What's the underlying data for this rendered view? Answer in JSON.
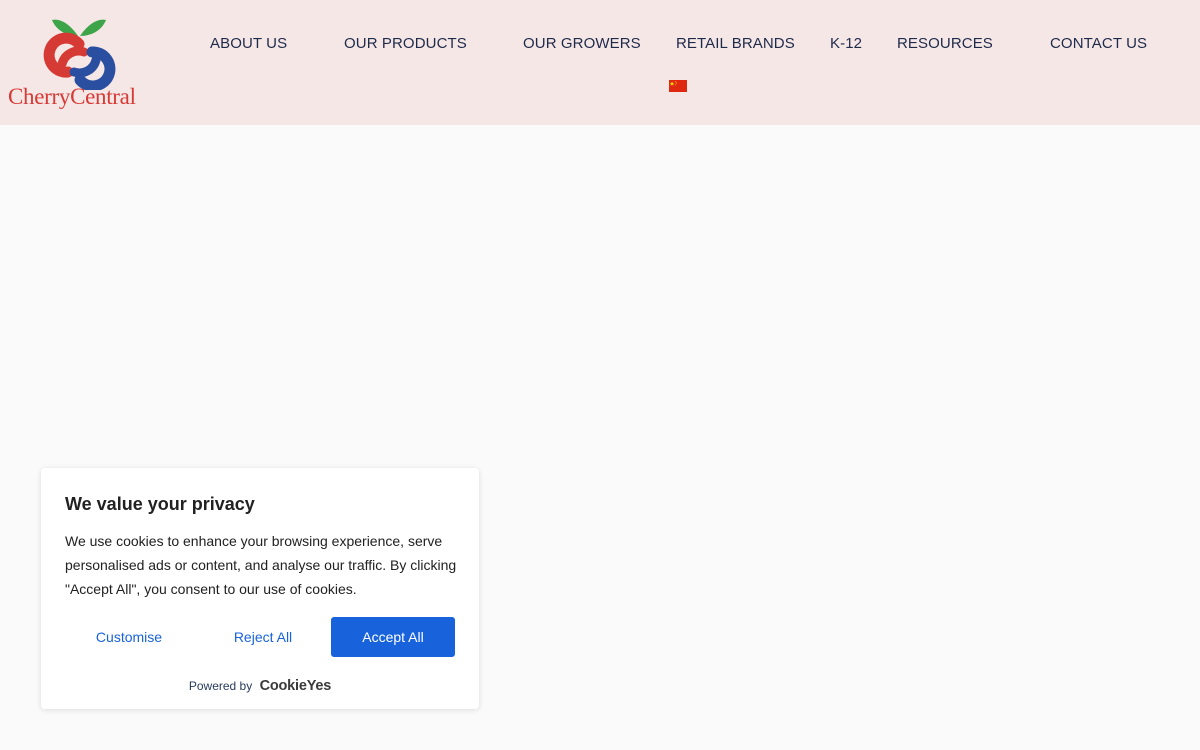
{
  "brand": {
    "logo_text": "CherryCentral",
    "logo_icon": "cherry-logo-icon"
  },
  "nav": {
    "items": [
      {
        "label": "ABOUT US"
      },
      {
        "label": "OUR PRODUCTS"
      },
      {
        "label": "OUR GROWERS"
      },
      {
        "label": "RETAIL BRANDS"
      },
      {
        "label": "K-12"
      },
      {
        "label": "RESOURCES"
      },
      {
        "label": "CONTACT US"
      }
    ],
    "language_flag_icon": "china-flag-icon"
  },
  "cookie_banner": {
    "title": "We value your privacy",
    "description": "We use cookies to enhance your browsing experience, serve personalised ads or content, and analyse our traffic. By clicking \"Accept All\", you consent to our use of cookies.",
    "customise_label": "Customise",
    "reject_label": "Reject All",
    "accept_label": "Accept All",
    "powered_by_label": "Powered by",
    "powered_by_brand": "CookieYes"
  },
  "colors": {
    "header_bg": "#f6e7e7",
    "nav_text": "#1e2a4a",
    "brand_red": "#d63a35",
    "brand_blue": "#2a4fa0",
    "leaf_green": "#3ea44a",
    "accept_button": "#1863dc"
  }
}
